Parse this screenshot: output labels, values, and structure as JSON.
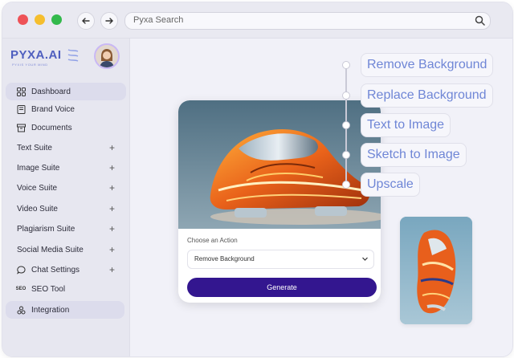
{
  "window": {
    "colors": {
      "close": "#ee5257",
      "minimize": "#f5be2e",
      "maximize": "#33b94c"
    }
  },
  "toolbar": {
    "search_text": "Pyxa Search"
  },
  "sidebar": {
    "logo": "PYXA.AI",
    "tagline": "PYXIS YOUR MIND",
    "items": [
      {
        "label": "Dashboard",
        "icon": "grid-icon",
        "active": true
      },
      {
        "label": "Brand Voice",
        "icon": "book-icon"
      },
      {
        "label": "Documents",
        "icon": "archive-icon"
      },
      {
        "label": "Text Suite",
        "expandable": true
      },
      {
        "label": "Image Suite",
        "expandable": true
      },
      {
        "label": "Voice Suite",
        "expandable": true
      },
      {
        "label": "Video Suite",
        "expandable": true
      },
      {
        "label": "Plagiarism Suite",
        "expandable": true
      },
      {
        "label": "Social Media Suite",
        "expandable": true
      },
      {
        "label": "Chat Settings",
        "icon": "chat-icon",
        "expandable": true
      },
      {
        "label": "SEO Tool",
        "icon": "seo-icon"
      },
      {
        "label": "Integration",
        "icon": "link-icon",
        "active": true
      }
    ]
  },
  "main": {
    "card": {
      "action_label": "Choose an Action",
      "selected_action": "Remove Background",
      "generate_label": "Generate"
    },
    "features": [
      "Remove Background",
      "Replace Background",
      "Text to Image",
      "Sketch to Image",
      "Upscale"
    ]
  },
  "colors": {
    "accent": "#33168f",
    "feature_text": "#6f86d6",
    "logo": "#4f5fbf"
  }
}
